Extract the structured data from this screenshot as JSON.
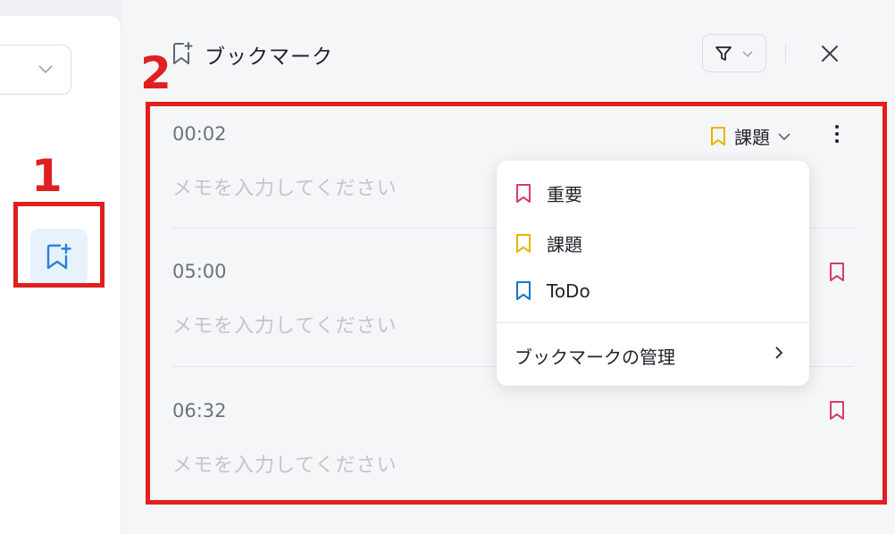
{
  "annotations": {
    "step1": "1",
    "step2": "2"
  },
  "header": {
    "title": "ブックマーク"
  },
  "entries": [
    {
      "time": "00:02",
      "memo_placeholder": "メモを入力してください",
      "tag": "課題"
    },
    {
      "time": "05:00",
      "memo_placeholder": "メモを入力してください"
    },
    {
      "time": "06:32",
      "memo_placeholder": "メモを入力してください"
    }
  ],
  "menu": {
    "items": [
      {
        "label": "重要",
        "color": "#d63c6e"
      },
      {
        "label": "課題",
        "color": "#e8b400"
      },
      {
        "label": "ToDo",
        "color": "#1a73c8"
      }
    ],
    "manage_label": "ブックマークの管理"
  },
  "colors": {
    "accent": "#2b7fd9",
    "annotation_red": "#e01f1f"
  },
  "icons": [
    "chevron-down-icon",
    "bookmark-add-icon",
    "filter-icon",
    "close-icon",
    "more-vertical-icon",
    "bookmark-icon",
    "chevron-right-icon"
  ]
}
